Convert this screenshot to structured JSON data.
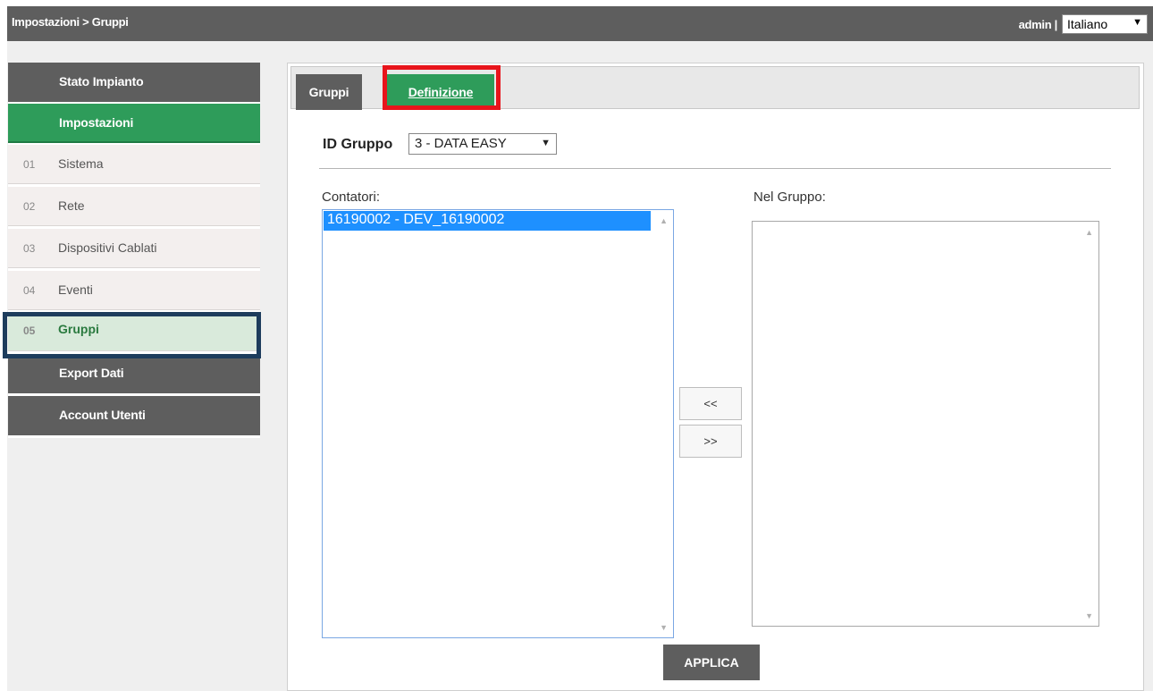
{
  "header": {
    "breadcrumb": "Impostazioni > Gruppi",
    "user_label": "admin |",
    "language": "Italiano"
  },
  "sidebar": {
    "stato_impianto": "Stato Impianto",
    "impostazioni": "Impostazioni",
    "items": [
      {
        "num": "01",
        "label": "Sistema"
      },
      {
        "num": "02",
        "label": "Rete"
      },
      {
        "num": "03",
        "label": "Dispositivi Cablati"
      },
      {
        "num": "04",
        "label": "Eventi"
      },
      {
        "num": "05",
        "label": "Gruppi"
      }
    ],
    "export_dati": "Export Dati",
    "account_utenti": "Account Utenti"
  },
  "tabs": {
    "gruppi": "Gruppi",
    "definizione": "Definizione"
  },
  "form": {
    "id_label": "ID Gruppo",
    "id_value": "3 - DATA EASY",
    "contatori_label": "Contatori:",
    "nel_gruppo_label": "Nel Gruppo:",
    "contatori_items": [
      "16190002 - DEV_16190002"
    ],
    "move_left_label": "<<",
    "move_right_label": ">>",
    "apply_label": "APPLICA"
  },
  "colors": {
    "accent_green": "#2e9c5a",
    "header_gray": "#5e5e5e",
    "highlight_red": "#e8141b",
    "highlight_navy": "#1d3c5c"
  }
}
